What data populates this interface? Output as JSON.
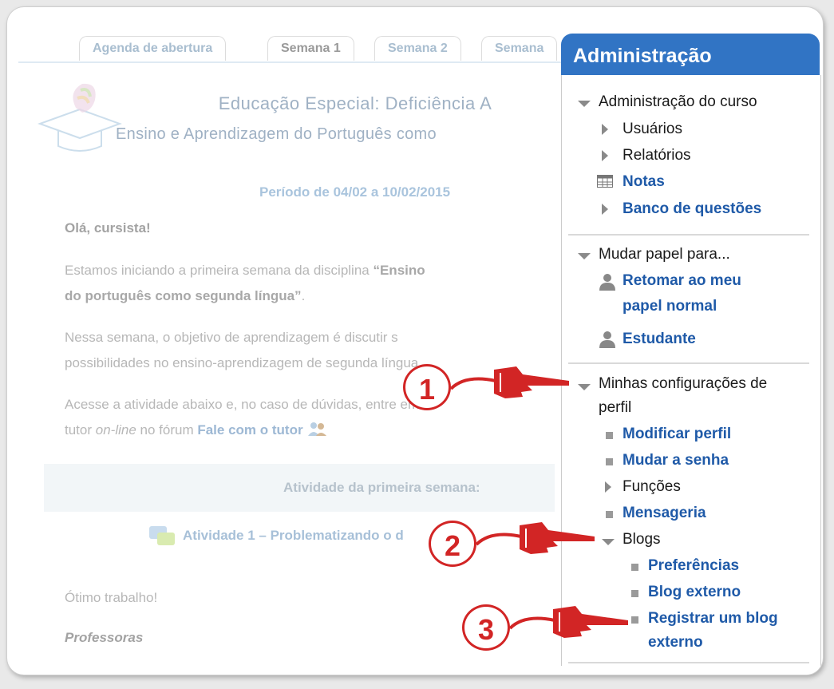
{
  "tabs": [
    "Agenda de abertura",
    "Semana 1",
    "Semana 2",
    "Semana"
  ],
  "course": {
    "title": "Educação Especial: Deficiência A",
    "subtitle": "Ensino e Aprendizagem do Português como",
    "period": "Período de 04/02 a 10/02/2015",
    "greeting": "Olá, cursista!",
    "p1_line1_pre": "Estamos iniciando a primeira semana da disciplina ",
    "p1_line1_bold": "“Ensino",
    "p1_line2_bold": "do português como segunda língua”",
    "p1_line2_post": ".",
    "p2_line1": "Nessa semana, o objetivo de aprendizagem é discutir s",
    "p2_line2": "possibilidades no ensino-aprendizagem de segunda língua.",
    "p3_line1": "Acesse a atividade abaixo e, no caso de dúvidas, entre em c",
    "p3_line2_pre": "tutor ",
    "p3_line2_italic": "on-line",
    "p3_line2_mid": " no fórum ",
    "p3_line2_link": "Fale com o tutor",
    "activity_box_label": "Atividade da primeira semana:",
    "activity_link": "Atividade 1 – Problematizando o d",
    "closing": "Ótimo trabalho!",
    "signature": "Professoras"
  },
  "admin": {
    "title": "Administração",
    "course_admin": "Administração do curso",
    "users": "Usuários",
    "reports": "Relatórios",
    "grades": "Notas",
    "question_bank": "Banco de questões",
    "switch_role": "Mudar papel para...",
    "return_role_1": "Retomar ao meu",
    "return_role_2": "papel normal",
    "student": "Estudante",
    "my_profile_1": "Minhas configurações de",
    "my_profile_2": "perfil",
    "edit_profile": "Modificar perfil",
    "change_password": "Mudar a senha",
    "roles": "Funções",
    "messaging": "Mensageria",
    "blogs": "Blogs",
    "preferences": "Preferências",
    "external_blog": "Blog externo",
    "register_blog_1": "Registrar um blog",
    "register_blog_2": "externo"
  },
  "callouts": [
    "1",
    "2",
    "3"
  ],
  "colors": {
    "header": "#3174c4",
    "link": "#1f5aa8",
    "callout": "#d22525"
  }
}
